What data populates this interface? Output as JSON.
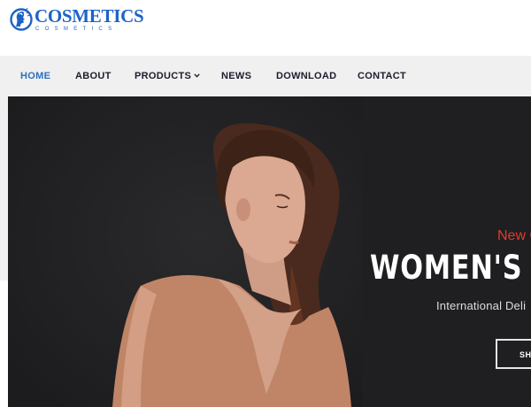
{
  "brand": {
    "name": "COSMETICS",
    "tagline": "COSMETICS",
    "color": "#1e63c6",
    "icon": "face-profile-logo"
  },
  "nav": {
    "items": [
      {
        "label": "HOME",
        "active": true
      },
      {
        "label": "ABOUT"
      },
      {
        "label": "PRODUCTS",
        "has_dropdown": true
      },
      {
        "label": "NEWS"
      },
      {
        "label": "DOWNLOAD"
      },
      {
        "label": "CONTACT"
      }
    ],
    "chevron_icon": "chevron-down-icon",
    "active_color": "#2d6fbe"
  },
  "hero": {
    "eyebrow": "New C",
    "title": "WOMEN'S FA",
    "subtitle": "International Deli",
    "button_label": "SHO",
    "accent_color": "#e43a2f",
    "background_color": "#1f1f21"
  }
}
